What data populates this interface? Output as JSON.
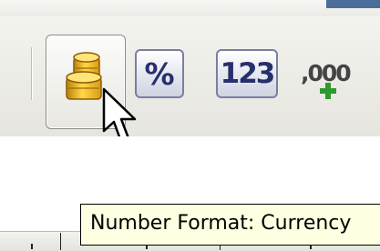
{
  "toolbar": {
    "buttons": [
      {
        "name": "Number Format: Currency",
        "icon": "coin-stack-icon",
        "state": "hovered"
      },
      {
        "name": "Number Format: Percent",
        "icon": "percent-icon",
        "label": "%"
      },
      {
        "name": "Number Format: Standard",
        "icon": "number-icon",
        "label": "123"
      },
      {
        "name": "Add Decimal Place",
        "icon": "add-decimal-icon",
        "label": ",000"
      }
    ]
  },
  "tooltip": {
    "text": "Number Format: Currency"
  },
  "colors": {
    "toolbar_bg": "#ecebe6",
    "tooltip_bg": "#ffffe1",
    "icon_text": "#27306c",
    "coin": "#e8b01a",
    "plus": "#2e9a2e"
  }
}
